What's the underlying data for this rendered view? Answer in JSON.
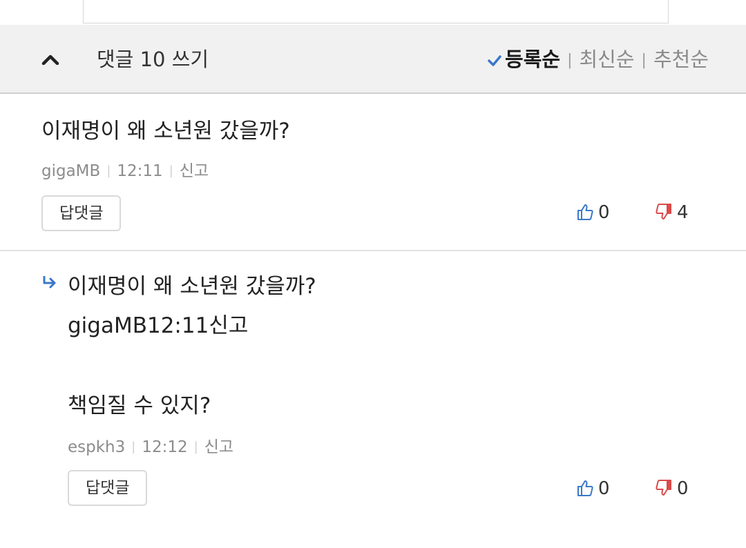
{
  "header": {
    "comment_count_label": "댓글 10 쓰기",
    "sort": {
      "active": "등록순",
      "options": [
        "최신순",
        "추천순"
      ]
    }
  },
  "comments": [
    {
      "text": "이재명이 왜 소년원 갔을까?",
      "author": "gigaMB",
      "time": "12:11",
      "report_label": "신고",
      "reply_label": "답댓글",
      "likes": "0",
      "dislikes": "4"
    }
  ],
  "reply": {
    "quoted_text": "이재명이 왜 소년원 갔을까?",
    "quoted_meta": "gigaMB12:11신고",
    "text": "책임질 수 있지?",
    "author": "espkh3",
    "time": "12:12",
    "report_label": "신고",
    "reply_label": "답댓글",
    "likes": "0",
    "dislikes": "0"
  },
  "colors": {
    "accent_blue": "#3a78c9",
    "dislike_red": "#d94a4a",
    "bar_bg": "#f1f1f1"
  },
  "icons": [
    "chevron-up-icon",
    "check-icon",
    "thumbs-up-icon",
    "thumbs-down-icon",
    "reply-arrow-icon"
  ]
}
